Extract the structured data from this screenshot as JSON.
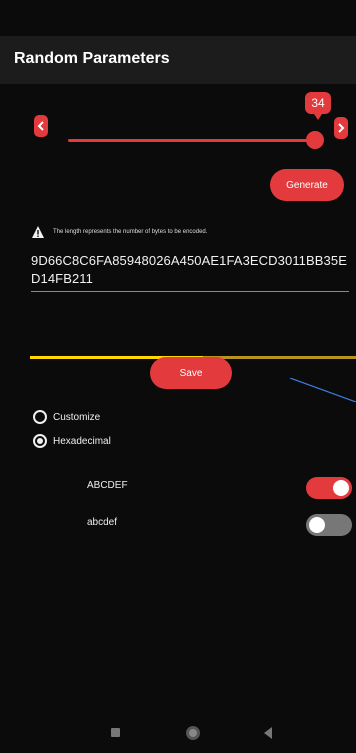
{
  "app": {
    "title": "Random Parameters"
  },
  "slider": {
    "value": "34",
    "fraction": 0.94
  },
  "buttons": {
    "generate": "Generate",
    "save": "Save"
  },
  "info": {
    "text": "The length represents the number of bytes to be encoded."
  },
  "output": {
    "hex": "9D66C8C6FA85948026A450AE1FA3ECD3011BB35ED14FB211"
  },
  "progress": {
    "fraction": 0.53
  },
  "options": {
    "customize": "Customize",
    "hexadecimal": "Hexadecimal",
    "selected": "hexadecimal"
  },
  "toggles": [
    {
      "label": "ABCDEF",
      "on": true
    },
    {
      "label": "abcdef",
      "on": false
    }
  ],
  "colors": {
    "accent": "#e23a3d",
    "progress": "#ffd800",
    "background": "#0b0b0b"
  },
  "icons": {
    "decrease": "chevron-left-icon",
    "increase": "chevron-right-icon",
    "warning": "warning-icon"
  }
}
